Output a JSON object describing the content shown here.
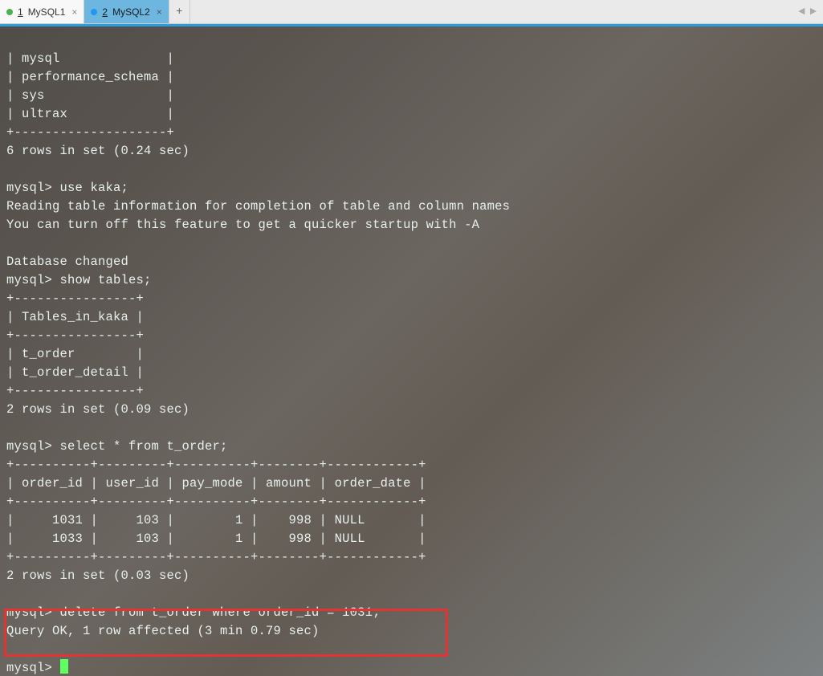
{
  "tabs": [
    {
      "index": "1",
      "label": "MySQL1",
      "status": "green",
      "active": false
    },
    {
      "index": "2",
      "label": "MySQL2",
      "status": "blue",
      "active": true
    }
  ],
  "terminal": {
    "db_list_rows": [
      "| mysql              |",
      "| performance_schema |",
      "| sys                |",
      "| ultrax             |"
    ],
    "db_list_border": "+--------------------+",
    "db_list_result": "6 rows in set (0.24 sec)",
    "use_cmd": "mysql> use kaka;",
    "use_msg1": "Reading table information for completion of table and column names",
    "use_msg2": "You can turn off this feature to get a quicker startup with -A",
    "db_changed": "Database changed",
    "show_tables_cmd": "mysql> show tables;",
    "tables_border": "+----------------+",
    "tables_header": "| Tables_in_kaka |",
    "tables_rows": [
      "| t_order        |",
      "| t_order_detail |"
    ],
    "tables_result": "2 rows in set (0.09 sec)",
    "select_cmd": "mysql> select * from t_order;",
    "order_border": "+----------+---------+----------+--------+------------+",
    "order_header": "| order_id | user_id | pay_mode | amount | order_date |",
    "order_rows": [
      "|     1031 |     103 |        1 |    998 | NULL       |",
      "|     1033 |     103 |        1 |    998 | NULL       |"
    ],
    "order_result": "2 rows in set (0.03 sec)",
    "delete_cmd": "mysql> delete from t_order where order_id = 1031;",
    "delete_result": "Query OK, 1 row affected (3 min 0.79 sec)",
    "prompt": "mysql> "
  },
  "chart_data": {
    "type": "table",
    "title": "t_order",
    "columns": [
      "order_id",
      "user_id",
      "pay_mode",
      "amount",
      "order_date"
    ],
    "rows": [
      [
        1031,
        103,
        1,
        998,
        null
      ],
      [
        1033,
        103,
        1,
        998,
        null
      ]
    ]
  }
}
